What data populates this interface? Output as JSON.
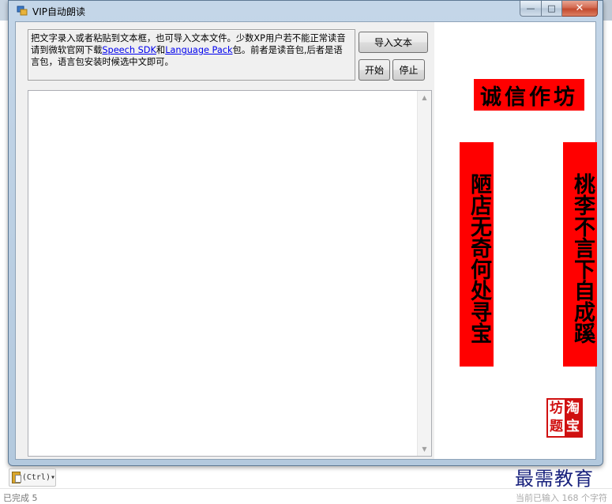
{
  "window": {
    "title": "VIP自动朗读",
    "min_label": "—",
    "max_label": "□",
    "close_label": "✕"
  },
  "instructions": {
    "text_before": "把文字录入或者粘贴到文本框，也可导入文本文件。少数XP用户若不能正常读音请到微软官网下载",
    "link_speech_sdk": "Speech SDK",
    "and": "和",
    "link_language_pack": "Language Pack",
    "text_after": "包。前者是读音包,后者是语言包，语言包安装时候选中文即可。"
  },
  "buttons": {
    "import": "导入文本",
    "start": "开始",
    "stop": "停止"
  },
  "textbox": {
    "value": ""
  },
  "decoration": {
    "banner": "诚信作坊",
    "couplet_left": "陋店无奇何处寻宝",
    "couplet_right": "桃李不言下自成蹊",
    "seal_chars": [
      "坊",
      "淘",
      "题",
      "宝"
    ]
  },
  "paste_options": {
    "label": "(Ctrl)▾"
  },
  "watermark": "最需教育",
  "status": {
    "left": "已完成 5",
    "right": "当前已输入 168 个字符"
  },
  "colors": {
    "banner_bg": "#ff0000",
    "seal": "#d01010",
    "watermark": "#1a237e",
    "link": "#0000ee"
  }
}
